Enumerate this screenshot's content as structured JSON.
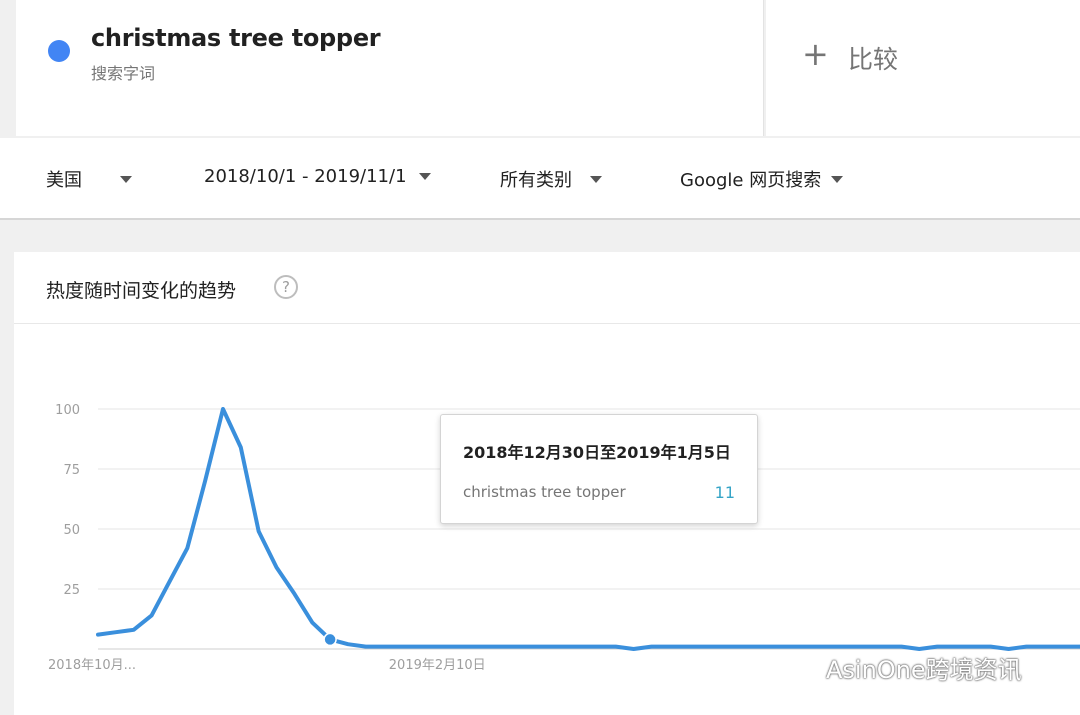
{
  "search_term": {
    "name": "christmas tree topper",
    "type_label": "搜索字词",
    "color": "#4285f4"
  },
  "compare": {
    "label": "比较"
  },
  "filters": {
    "region": "美国",
    "date_range": "2018/10/1 - 2019/11/1",
    "category": "所有类别",
    "search_type": "Google 网页搜索"
  },
  "panel": {
    "title": "热度随时间变化的趋势"
  },
  "tooltip": {
    "date": "2018年12月30日至2019年1月5日",
    "term": "christmas tree topper",
    "value": "11"
  },
  "watermark": "AsinOne跨境资讯",
  "chart_data": {
    "type": "line",
    "ylim": [
      0,
      100
    ],
    "yticks": [
      25,
      50,
      75,
      100
    ],
    "xticks": [
      {
        "label": "2018年10月...",
        "index": 0
      },
      {
        "label": "2019年2月10日",
        "index": 19
      }
    ],
    "line_color": "#3a8fdc",
    "grid": true,
    "highlight_index": 13,
    "series": [
      {
        "x": [
          "2018-10-07",
          "2018-10-14",
          "2018-10-21",
          "2018-10-28",
          "2018-11-04",
          "2018-11-11",
          "2018-11-18",
          "2018-11-25",
          "2018-12-02",
          "2018-12-09",
          "2018-12-16",
          "2018-12-23",
          "2018-12-30",
          "2019-01-06",
          "2019-01-13",
          "2019-01-20",
          "2019-01-27",
          "2019-02-03",
          "2019-02-10",
          "2019-02-17",
          "2019-02-24",
          "2019-03-03",
          "2019-03-10",
          "2019-03-17",
          "2019-03-24",
          "2019-03-31",
          "2019-04-07",
          "2019-04-14",
          "2019-04-21",
          "2019-04-28",
          "2019-05-05",
          "2019-05-12",
          "2019-05-19",
          "2019-05-26",
          "2019-06-02",
          "2019-06-09",
          "2019-06-16",
          "2019-06-23",
          "2019-06-30",
          "2019-07-07",
          "2019-07-14",
          "2019-07-21",
          "2019-07-28",
          "2019-08-04",
          "2019-08-11",
          "2019-08-18",
          "2019-08-25",
          "2019-09-01",
          "2019-09-08",
          "2019-09-15",
          "2019-09-22",
          "2019-09-29",
          "2019-10-06",
          "2019-10-13",
          "2019-10-20",
          "2019-10-27"
        ],
        "values": [
          6,
          7,
          8,
          14,
          28,
          42,
          70,
          100,
          84,
          49,
          34,
          23,
          11,
          4,
          2,
          1,
          1,
          1,
          1,
          1,
          1,
          1,
          1,
          1,
          1,
          1,
          1,
          1,
          1,
          1,
          0,
          1,
          1,
          1,
          1,
          1,
          1,
          1,
          1,
          1,
          1,
          1,
          1,
          1,
          1,
          1,
          0,
          1,
          1,
          1,
          1,
          0,
          1,
          1,
          1,
          1
        ]
      }
    ]
  }
}
